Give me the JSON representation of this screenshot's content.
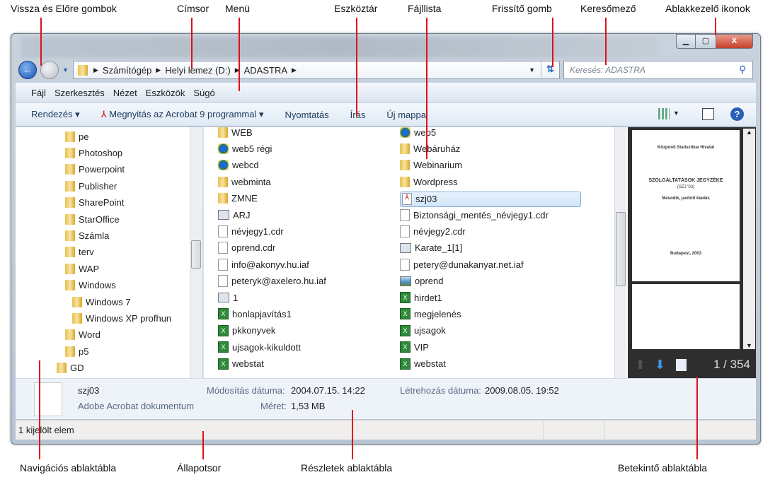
{
  "annotations": {
    "top": [
      "Vissza és Előre gombok",
      "Címsor",
      "Menü",
      "Eszköztár",
      "Fájllista",
      "Frissítő gomb",
      "Keresőmező",
      "Ablakkezelő ikonok"
    ],
    "bottom": [
      "Navigációs ablaktábla",
      "Állapotsor",
      "Részletek ablaktábla",
      "Betekintő ablaktábla"
    ],
    "line_color": "#e0101a"
  },
  "window_controls": {
    "minimize": "▁",
    "maximize": "▢",
    "close": "X"
  },
  "address": {
    "crumbs": [
      "Számítógép",
      "Helyi lemez (D:)",
      "ADASTRA"
    ],
    "search_placeholder": "Keresés: ADASTRA"
  },
  "menu": [
    "Fájl",
    "Szerkesztés",
    "Nézet",
    "Eszközök",
    "Súgó"
  ],
  "toolbar": {
    "organize": "Rendezés",
    "open_with": "Megnyitás az Acrobat 9 programmal",
    "print": "Nyomtatás",
    "burn": "Írás",
    "new_folder": "Új mappa"
  },
  "nav": [
    {
      "label": "pe",
      "level": 2
    },
    {
      "label": "Photoshop",
      "level": 2
    },
    {
      "label": "Powerpoint",
      "level": 2
    },
    {
      "label": "Publisher",
      "level": 2
    },
    {
      "label": "SharePoint",
      "level": 2
    },
    {
      "label": "StarOffice",
      "level": 2
    },
    {
      "label": "Számla",
      "level": 2
    },
    {
      "label": "terv",
      "level": 2
    },
    {
      "label": "WAP",
      "level": 2
    },
    {
      "label": "Windows",
      "level": 2
    },
    {
      "label": "Windows 7",
      "level": 3
    },
    {
      "label": "Windows XP profhun",
      "level": 3
    },
    {
      "label": "Word",
      "level": 2
    },
    {
      "label": "p5",
      "level": 2
    },
    {
      "label": "GD",
      "level": 1
    }
  ],
  "files": {
    "col1": [
      {
        "name": "WEB",
        "icon": "folder"
      },
      {
        "name": "web5 régi",
        "icon": "web"
      },
      {
        "name": "webcd",
        "icon": "web"
      },
      {
        "name": "webminta",
        "icon": "folder"
      },
      {
        "name": "ZMNE",
        "icon": "folder"
      },
      {
        "name": "ARJ",
        "icon": "misc"
      },
      {
        "name": "névjegy1.cdr",
        "icon": "doc"
      },
      {
        "name": "oprend.cdr",
        "icon": "doc"
      },
      {
        "name": "info@akonyv.hu.iaf",
        "icon": "doc"
      },
      {
        "name": "peteryk@axelero.hu.iaf",
        "icon": "doc"
      },
      {
        "name": "1",
        "icon": "misc"
      },
      {
        "name": "honlapjavítás1",
        "icon": "xls"
      },
      {
        "name": "pkkonyvek",
        "icon": "xls"
      },
      {
        "name": "ujsagok-kikuldott",
        "icon": "xls"
      },
      {
        "name": "webstat",
        "icon": "xls"
      }
    ],
    "col2": [
      {
        "name": "web5",
        "icon": "web"
      },
      {
        "name": "Webáruház",
        "icon": "folder"
      },
      {
        "name": "Webinarium",
        "icon": "folder"
      },
      {
        "name": "Wordpress",
        "icon": "folder"
      },
      {
        "name": "szj03",
        "icon": "pdf",
        "selected": true
      },
      {
        "name": "Biztonsági_mentés_névjegy1.cdr",
        "icon": "doc"
      },
      {
        "name": "névjegy2.cdr",
        "icon": "doc"
      },
      {
        "name": "Karate_1[1]",
        "icon": "misc"
      },
      {
        "name": "petery@dunakanyar.net.iaf",
        "icon": "doc"
      },
      {
        "name": "oprend",
        "icon": "img"
      },
      {
        "name": "hirdet1",
        "icon": "xls"
      },
      {
        "name": "megjelenés",
        "icon": "xls"
      },
      {
        "name": "ujsagok",
        "icon": "xls"
      },
      {
        "name": "VIP",
        "icon": "xls"
      },
      {
        "name": "webstat",
        "icon": "xls"
      }
    ]
  },
  "preview": {
    "page1": [
      "Központi Statisztikai Hivatal",
      "SZOLGÁLTATÁSOK JEGYZÉKE",
      "(SZJ '03)",
      "Második, javított kiadás",
      "Budapest, 2003"
    ],
    "page_counter": "1 / 354"
  },
  "details": {
    "name": "szj03",
    "type": "Adobe Acrobat dokumentum",
    "modified_label": "Módosítás dátuma:",
    "modified": "2004.07.15. 14:22",
    "created_label": "Létrehozás dátuma:",
    "created": "2009.08.05. 19:52",
    "size_label": "Méret:",
    "size": "1,53 MB"
  },
  "status": {
    "text": "1 kijelölt elem"
  }
}
